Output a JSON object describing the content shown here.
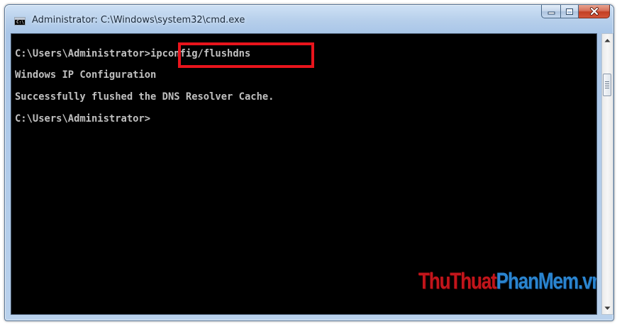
{
  "window": {
    "title": "Administrator: C:\\Windows\\system32\\cmd.exe",
    "icon": "cmd-icon",
    "icon_text": "C:\\",
    "controls": {
      "minimize": "minimize-icon",
      "maximize": "maximize-icon",
      "close": "close-icon"
    }
  },
  "console": {
    "lines": [
      {
        "prompt": "C:\\Users\\Administrator>",
        "command": "ipconfig/flushdns"
      },
      {
        "text": "Windows IP Configuration"
      },
      {
        "text": "Successfully flushed the DNS Resolver Cache."
      },
      {
        "text": "C:\\Users\\Administrator>"
      }
    ],
    "colors": {
      "background": "#000000",
      "text": "#c0c0c0",
      "highlight": "#e8141c"
    }
  },
  "watermark": {
    "part1": "ThuThuat",
    "part2": "PhanMem.vn"
  },
  "scrollbar": {
    "up": "scroll-up-arrow-icon",
    "down": "scroll-down-arrow-icon"
  }
}
